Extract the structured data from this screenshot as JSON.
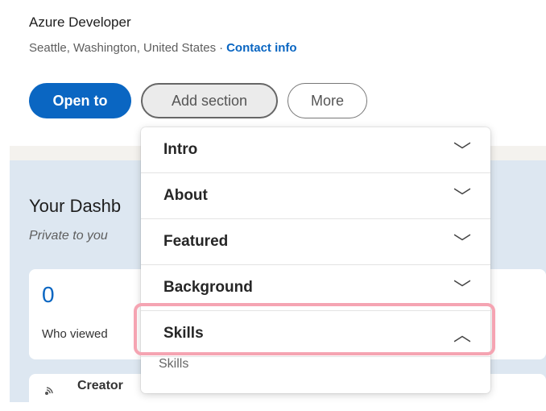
{
  "profile": {
    "headline": "Azure Developer",
    "location": "Seattle, Washington, United States",
    "separator": "·",
    "contact_link": "Contact info"
  },
  "actions": {
    "open_to": "Open to",
    "add_section": "Add section",
    "more": "More"
  },
  "dashboard": {
    "title": "Your Dashb",
    "subtitle": "Private to you",
    "stat_value": "0",
    "stat_label": "Who viewed",
    "creator_label": "Creator",
    "creator_icon": "broadcast-icon"
  },
  "dropdown": {
    "items": [
      {
        "label": "Intro",
        "expanded": false,
        "chevron": "﹀"
      },
      {
        "label": "About",
        "expanded": false,
        "chevron": "﹀"
      },
      {
        "label": "Featured",
        "expanded": false,
        "chevron": "﹀"
      },
      {
        "label": "Background",
        "expanded": false,
        "chevron": "﹀"
      },
      {
        "label": "Skills",
        "expanded": true,
        "chevron": "︿"
      }
    ],
    "sub_item": "Skills"
  },
  "colors": {
    "accent": "#0a66c2",
    "highlight": "#f5a4b2",
    "dashboard_bg": "#dde7f1"
  }
}
